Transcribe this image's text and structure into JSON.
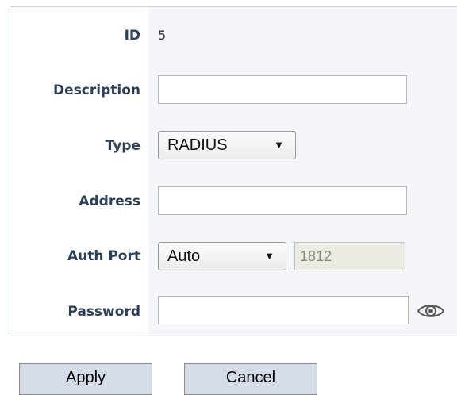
{
  "form": {
    "id": {
      "label": "ID",
      "value": "5"
    },
    "description": {
      "label": "Description",
      "value": ""
    },
    "type": {
      "label": "Type",
      "selected": "RADIUS"
    },
    "address": {
      "label": "Address",
      "value": ""
    },
    "auth_port": {
      "label": "Auth Port",
      "mode_selected": "Auto",
      "port_value": "1812"
    },
    "password": {
      "label": "Password",
      "value": ""
    }
  },
  "icons": {
    "select_caret": "▼",
    "password_toggle": "eye-icon"
  },
  "buttons": {
    "apply": "Apply",
    "cancel": "Cancel"
  },
  "colors": {
    "label_text": "#2c3f5a",
    "panel_bg": "#f3f5f9",
    "button_bg": "#d6dce7",
    "disabled_input_bg": "#ebebe4"
  }
}
